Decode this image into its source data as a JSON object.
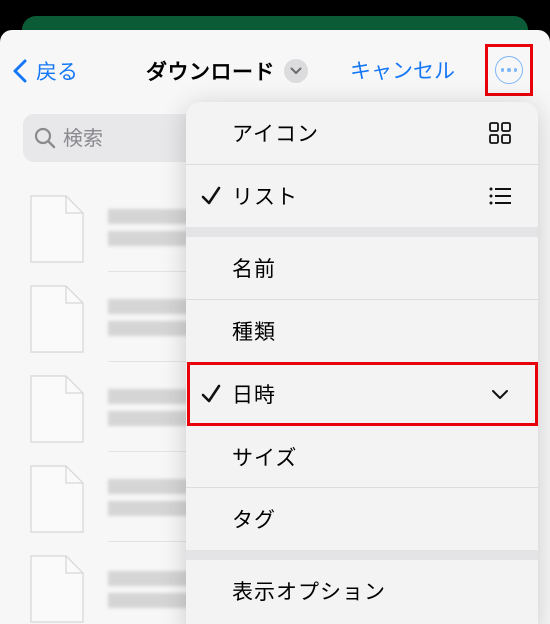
{
  "colors": {
    "accent": "#1577f6",
    "highlight": "#e8000b",
    "sheet_background": "#f7f7f7",
    "menu_background": "#f3f3f3"
  },
  "nav": {
    "back_label": "戻る",
    "title": "ダウンロード",
    "cancel_label": "キャンセル",
    "more_icon": "ellipsis-circle-icon"
  },
  "search": {
    "placeholder": "検索",
    "icon": "search-icon"
  },
  "menu": {
    "items": [
      {
        "label": "アイコン",
        "checked": false,
        "icon": "grid-icon"
      },
      {
        "label": "リスト",
        "checked": true,
        "icon": "list-icon"
      },
      {
        "label": "名前",
        "checked": false
      },
      {
        "label": "種類",
        "checked": false
      },
      {
        "label": "日時",
        "checked": true,
        "icon": "chevron-down-icon"
      },
      {
        "label": "サイズ",
        "checked": false
      },
      {
        "label": "タグ",
        "checked": false
      },
      {
        "label": "表示オプション",
        "checked": false
      }
    ]
  }
}
